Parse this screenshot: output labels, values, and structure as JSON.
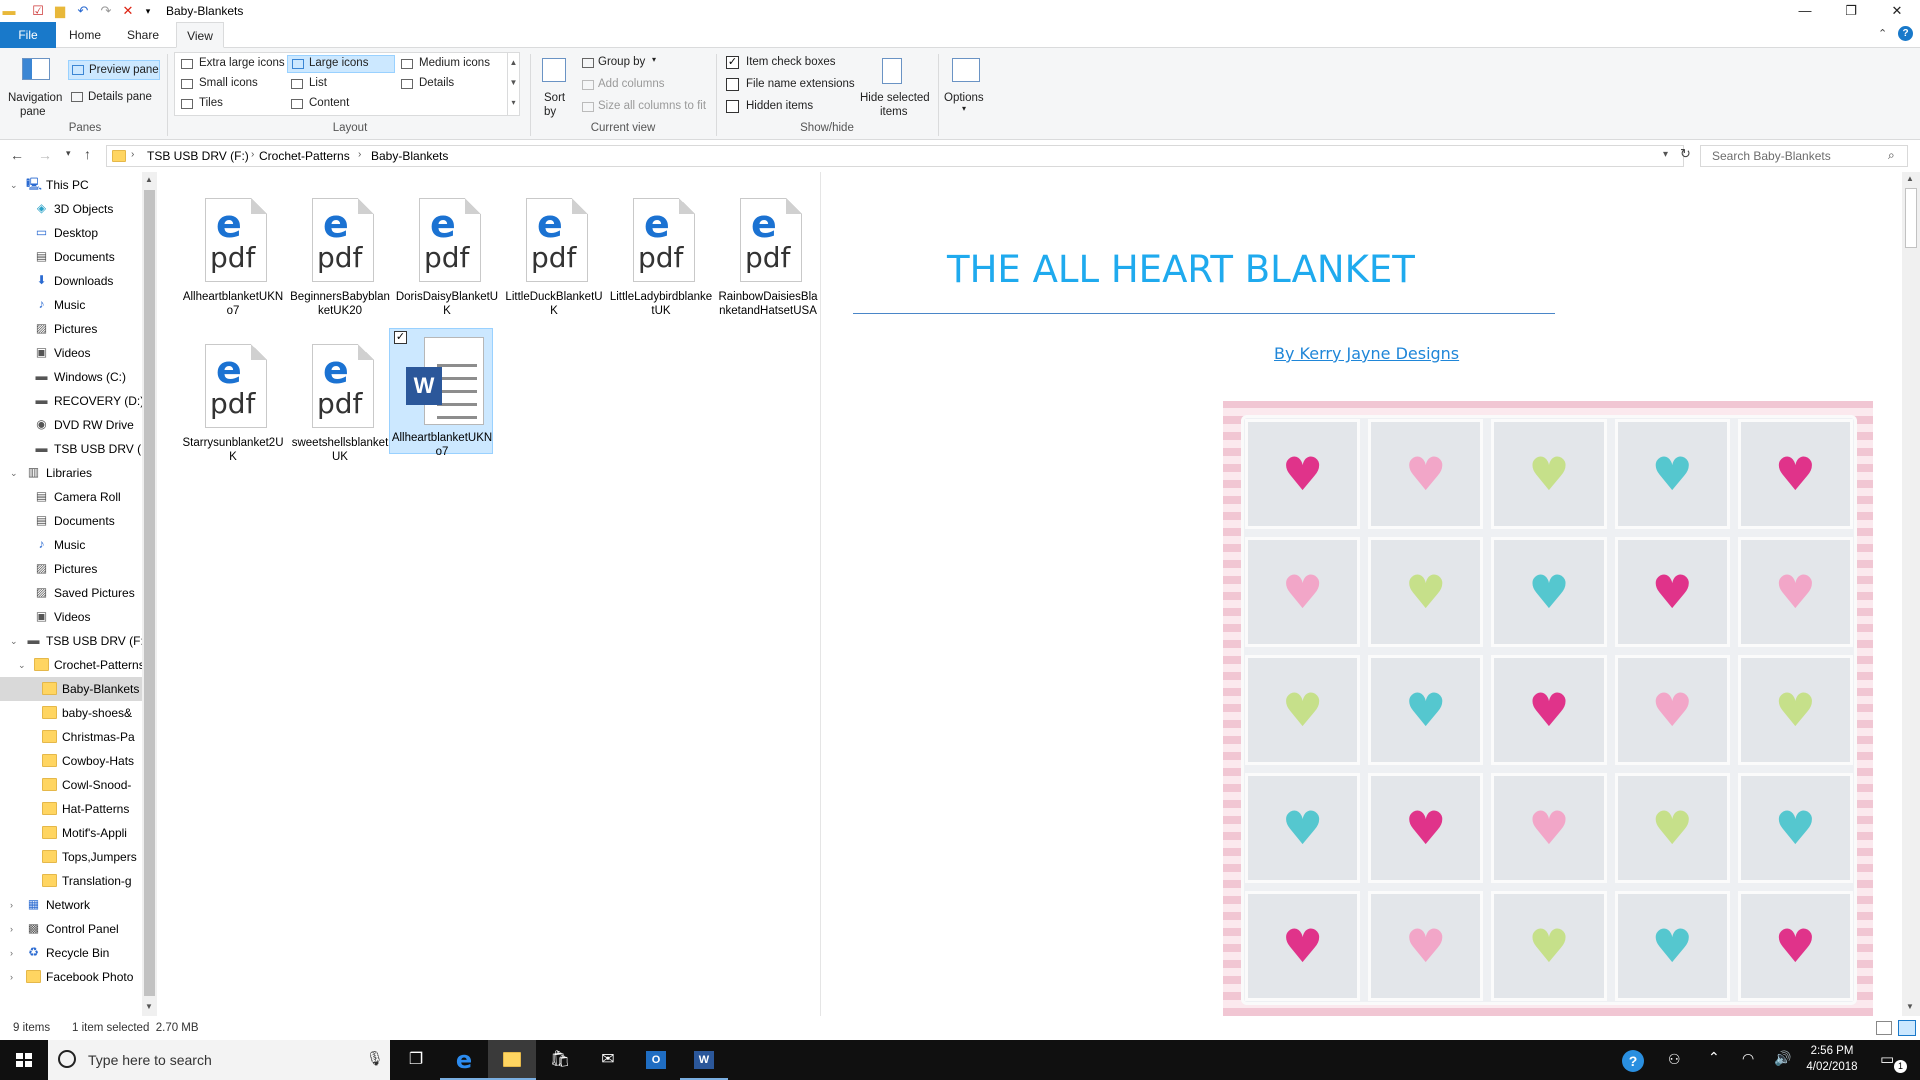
{
  "window": {
    "title": "Baby-Blankets"
  },
  "ribbon_tabs": [
    "File",
    "Home",
    "Share",
    "View"
  ],
  "ribbon": {
    "panes": {
      "navigation_pane": "Navigation",
      "navigation_pane2": "pane",
      "preview_pane": "Preview pane",
      "details_pane": "Details pane",
      "group": "Panes"
    },
    "layout": {
      "items": [
        "Extra large icons",
        "Large icons",
        "Medium icons",
        "Small icons",
        "List",
        "Details",
        "Tiles",
        "Content"
      ],
      "group": "Layout"
    },
    "current_view": {
      "sort_by": "Sort",
      "sort_by2": "by",
      "group_by": "Group by",
      "add_columns": "Add columns",
      "size_all": "Size all columns to fit",
      "group": "Current view"
    },
    "show_hide": {
      "item_check_boxes": "Item check boxes",
      "file_name_extensions": "File name extensions",
      "hidden_items": "Hidden items",
      "hide_selected": "Hide selected",
      "hide_selected2": "items",
      "group": "Show/hide"
    },
    "options": "Options"
  },
  "address": {
    "crumbs": [
      "TSB USB DRV (F:)",
      "Crochet-Patterns",
      "Baby-Blankets"
    ],
    "search_placeholder": "Search Baby-Blankets"
  },
  "nav": [
    {
      "label": "This PC",
      "icon": "pc-icon"
    },
    {
      "label": "3D Objects",
      "icon": "cube-icon"
    },
    {
      "label": "Desktop",
      "icon": "desktop-icon"
    },
    {
      "label": "Documents",
      "icon": "documents-icon"
    },
    {
      "label": "Downloads",
      "icon": "download-icon"
    },
    {
      "label": "Music",
      "icon": "music-icon"
    },
    {
      "label": "Pictures",
      "icon": "pictures-icon"
    },
    {
      "label": "Videos",
      "icon": "videos-icon"
    },
    {
      "label": "Windows (C:)",
      "icon": "drive-icon"
    },
    {
      "label": "RECOVERY (D:)",
      "icon": "drive-icon"
    },
    {
      "label": "DVD RW Drive",
      "icon": "dvd-icon"
    },
    {
      "label": "TSB USB DRV (F:)",
      "icon": "usb-drive-icon"
    },
    {
      "label": "Libraries",
      "icon": "libraries-icon"
    },
    {
      "label": "Camera Roll",
      "icon": "camera-roll-icon"
    },
    {
      "label": "Documents",
      "icon": "documents-icon"
    },
    {
      "label": "Music",
      "icon": "music-icon"
    },
    {
      "label": "Pictures",
      "icon": "pictures-icon"
    },
    {
      "label": "Saved Pictures",
      "icon": "pictures-icon"
    },
    {
      "label": "Videos",
      "icon": "videos-icon"
    },
    {
      "label": "TSB USB DRV (F:)",
      "icon": "usb-drive-icon"
    },
    {
      "label": "Crochet-Patterns",
      "icon": "folder-icon"
    },
    {
      "label": "Baby-Blankets",
      "icon": "folder-icon"
    },
    {
      "label": "baby-shoes&",
      "icon": "folder-icon"
    },
    {
      "label": "Christmas-Pa",
      "icon": "folder-icon"
    },
    {
      "label": "Cowboy-Hats",
      "icon": "folder-icon"
    },
    {
      "label": "Cowl-Snood-",
      "icon": "folder-icon"
    },
    {
      "label": "Hat-Patterns",
      "icon": "folder-icon"
    },
    {
      "label": "Motif's-Appli",
      "icon": "folder-icon"
    },
    {
      "label": "Tops,Jumpers",
      "icon": "folder-icon"
    },
    {
      "label": "Translation-g",
      "icon": "folder-icon"
    },
    {
      "label": "Network",
      "icon": "network-icon"
    },
    {
      "label": "Control Panel",
      "icon": "control-panel-icon"
    },
    {
      "label": "Recycle Bin",
      "icon": "recycle-bin-icon"
    },
    {
      "label": "Facebook Photo",
      "icon": "folder-icon"
    }
  ],
  "files": [
    {
      "name": "AllheartblanketUKNo7",
      "type": "pdf"
    },
    {
      "name": "BeginnersBabyblanketUK20",
      "type": "pdf"
    },
    {
      "name": "DorisDaisyBlanketUK",
      "type": "pdf"
    },
    {
      "name": "LittleDuckBlanketUK",
      "type": "pdf"
    },
    {
      "name": "LittleLadybirdblanketUK",
      "type": "pdf"
    },
    {
      "name": "RainbowDaisiesBlanketandHatsetUSA",
      "type": "pdf"
    },
    {
      "name": "Starrysunblanket2UK",
      "type": "pdf"
    },
    {
      "name": "sweetshellsblanketUK",
      "type": "pdf"
    },
    {
      "name": "AllheartblanketUKNo7",
      "type": "word"
    }
  ],
  "pdf_icon_text": {
    "logo": "e",
    "ext": "pdf"
  },
  "preview": {
    "title": "THE ALL HEART BLANKET",
    "byline": "By Kerry Jayne Designs",
    "heart_colors": [
      [
        "#e0338a",
        "#f2a6c8",
        "#c6e08a",
        "#55c7cf",
        "#e0338a"
      ],
      [
        "#f2a6c8",
        "#c6e08a",
        "#55c7cf",
        "#e0338a",
        "#f2a6c8"
      ],
      [
        "#c6e08a",
        "#55c7cf",
        "#e0338a",
        "#f2a6c8",
        "#c6e08a"
      ],
      [
        "#55c7cf",
        "#e0338a",
        "#f2a6c8",
        "#c6e08a",
        "#55c7cf"
      ],
      [
        "#e0338a",
        "#f2a6c8",
        "#c6e08a",
        "#55c7cf",
        "#e0338a"
      ]
    ]
  },
  "status": {
    "count": "9 items",
    "selected": "1 item selected  2.70 MB"
  },
  "taskbar": {
    "search_placeholder": "Type here to search",
    "time": "2:56 PM",
    "date": "4/02/2018",
    "notifications": "1"
  },
  "colors": {
    "accent": "#1979ca",
    "selection": "#cce8ff",
    "title_blue": "#1faaee"
  }
}
